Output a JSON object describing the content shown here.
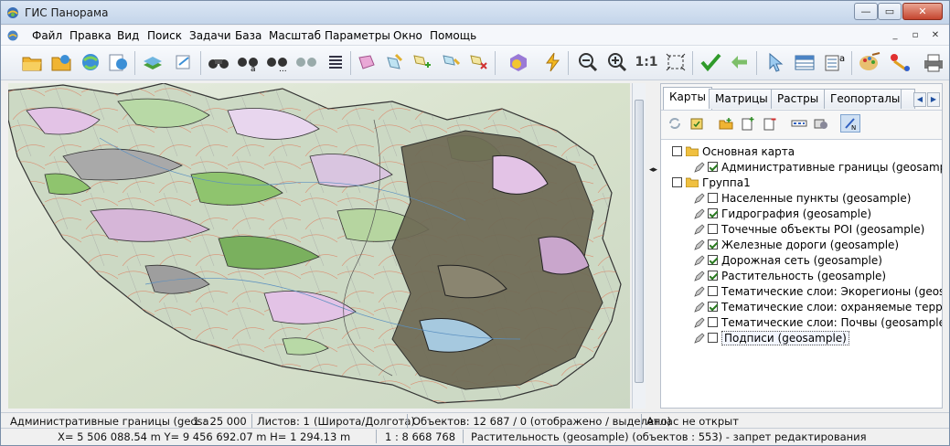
{
  "window": {
    "title": "ГИС Панорама",
    "min": "—",
    "max": "▭",
    "close": "✕"
  },
  "menu": [
    "Файл",
    "Правка",
    "Вид",
    "Поиск",
    "Задачи",
    "База",
    "Масштаб",
    "Параметры",
    "Окно",
    "Помощь"
  ],
  "toolbar": {
    "scale_label": "1:1"
  },
  "panel": {
    "tabs": [
      "Карты",
      "Матрицы",
      "Растры",
      "Геопорталы"
    ],
    "tree": [
      {
        "label": "Основная карта",
        "level": 0,
        "folder": true,
        "checked": false
      },
      {
        "label": "Административные границы (geosample)",
        "level": 1,
        "checked": true
      },
      {
        "label": "Группа1",
        "level": 0,
        "folder": true,
        "checked": false
      },
      {
        "label": "Населенные пункты (geosample)",
        "level": 1,
        "checked": false
      },
      {
        "label": "Гидрография (geosample)",
        "level": 1,
        "checked": true
      },
      {
        "label": "Точечные объекты POI (geosample)",
        "level": 1,
        "checked": false
      },
      {
        "label": "Железные дороги (geosample)",
        "level": 1,
        "checked": true
      },
      {
        "label": "Дорожная сеть (geosample)",
        "level": 1,
        "checked": true
      },
      {
        "label": "Растительность (geosample)",
        "level": 1,
        "checked": true
      },
      {
        "label": "Тематические слои: Экорегионы (geosamp",
        "level": 1,
        "checked": false
      },
      {
        "label": "Тематические слои: охраняемые территор",
        "level": 1,
        "checked": true
      },
      {
        "label": "Тематические слои: Почвы (geosample)",
        "level": 1,
        "checked": false
      },
      {
        "label": "Подписи (geosample)",
        "level": 1,
        "checked": false,
        "selected": true
      }
    ]
  },
  "status": {
    "layer": "Административные границы (geosa",
    "scale": "1 : 25 000",
    "sheets": "Листов: 1",
    "projection": "(Широта/Долгота)",
    "objects": "Объектов: 12 687 / 0 (отображено / выделено)",
    "atlas": "Атлас не открыт",
    "coords": "X= 5 506 088.54 m  Y= 9 456 692.07 m  H= 1 294.13 m",
    "map_scale": "1 : 8 668 768",
    "edit_info": "Растительность (geosample)   (объектов : 553) - запрет редактирования"
  },
  "colors": {
    "accent": "#3a6fb6",
    "map_dark": "#6e6a55",
    "map_green": "#8fc46e",
    "map_pink": "#e3c3e6",
    "map_gray": "#a9a9a9"
  }
}
